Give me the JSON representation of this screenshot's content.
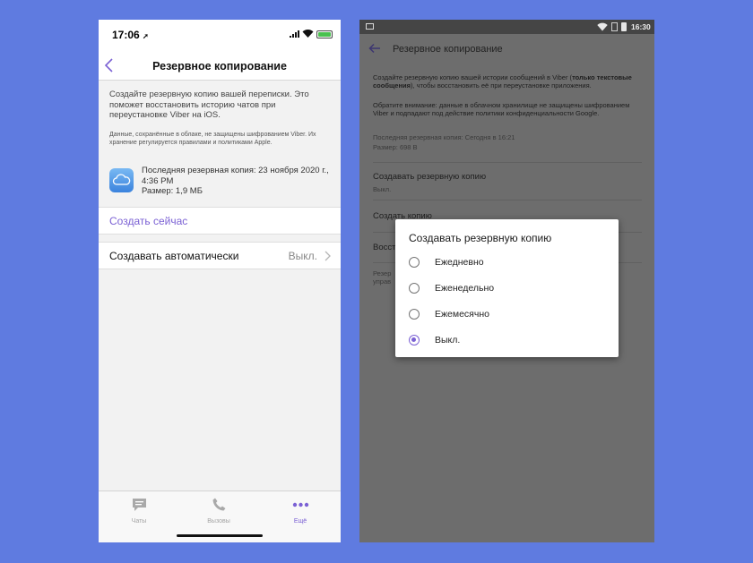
{
  "ios": {
    "time": "17:06",
    "location_glyph": "➚",
    "title": "Резервное копирование",
    "description": "Создайте резервную копию вашей переписки. Это поможет восстановить историю чатов при переустановке Viber на iOS.",
    "note": "Данные, сохранённые в облаке, не защищены шифрованием Viber. Их хранение регулируется правилами и политиками Apple.",
    "last_backup": "Последняя резервная копия: 23 ноября 2020 г., 4:36 PM",
    "size": "Размер: 1,9 МБ",
    "create_now": "Создать сейчас",
    "auto": {
      "label": "Создавать автоматически",
      "value": "Выкл."
    },
    "tabs": [
      {
        "label": "Чаты",
        "icon": "chat-bubble-icon"
      },
      {
        "label": "Вызовы",
        "icon": "phone-icon"
      },
      {
        "label": "Ещё",
        "icon": "more-dots-icon"
      }
    ],
    "accent_color": "#7b61d4"
  },
  "android": {
    "time": "16:30",
    "title": "Резервное копирование",
    "desc_start": "Создайте резервную копию вашей истории сообщений в Viber (",
    "desc_bold": "только текстовые сообщения",
    "desc_end": "), чтобы восстановить её при переустановке приложения.",
    "warning": "Обратите внимание: данные в облачном хранилище не защищены шифрованием Viber и подпадают под действие политики конфиденциальности Google.",
    "last_backup": "Последняя резервная копия: Сегодня в 16:21",
    "size": "Размер: 698 B",
    "setting_label": "Создавать резервную копию",
    "setting_value": "Выкл.",
    "create_now": "Создать копию",
    "restore_partial": "Восст",
    "footer_partial_1": "Резер",
    "footer_partial_2": "управ",
    "dialog": {
      "title": "Создавать резервную копию",
      "options": [
        "Ежедневно",
        "Еженедельно",
        "Ежемесячно",
        "Выкл."
      ],
      "selected": "Выкл."
    }
  }
}
